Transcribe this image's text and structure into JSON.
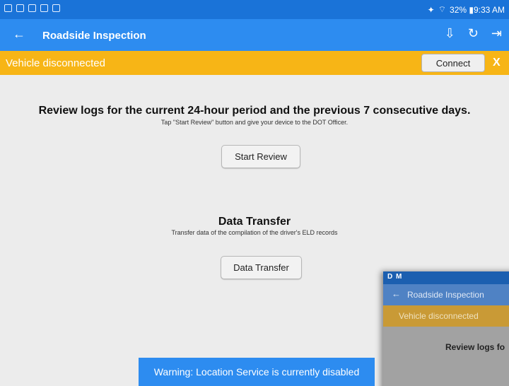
{
  "status_bar": {
    "right_text": "32% ▮9:33 AM"
  },
  "app_bar": {
    "title": "Roadside Inspection",
    "back_icon": "arrow-left-icon",
    "icons": [
      "download-icon",
      "refresh-icon",
      "logout-icon"
    ]
  },
  "vehicle_bar": {
    "message": "Vehicle disconnected",
    "connect_label": "Connect",
    "close_label": "X"
  },
  "review": {
    "heading": "Review logs for the current 24-hour period and the previous 7 consecutive days.",
    "instruction": "Tap \"Start Review\" button and give your device to the DOT Officer.",
    "button_label": "Start Review"
  },
  "data_transfer": {
    "heading": "Data Transfer",
    "instruction": "Transfer data of the compilation of the driver's ELD records",
    "button_label": "Data Transfer"
  },
  "toast": {
    "message": "Warning: Location Service is currently disabled"
  },
  "overlay": {
    "status_text": "D M",
    "title": "Roadside Inspection",
    "vehicle_message": "Vehicle disconnected",
    "heading_fragment": "Review logs fo"
  },
  "colors": {
    "status_bar": "#1a73d8",
    "app_bar": "#2d8cf0",
    "warning_bar": "#f7b516",
    "toast": "#2d8cf0",
    "background": "#ececec"
  }
}
